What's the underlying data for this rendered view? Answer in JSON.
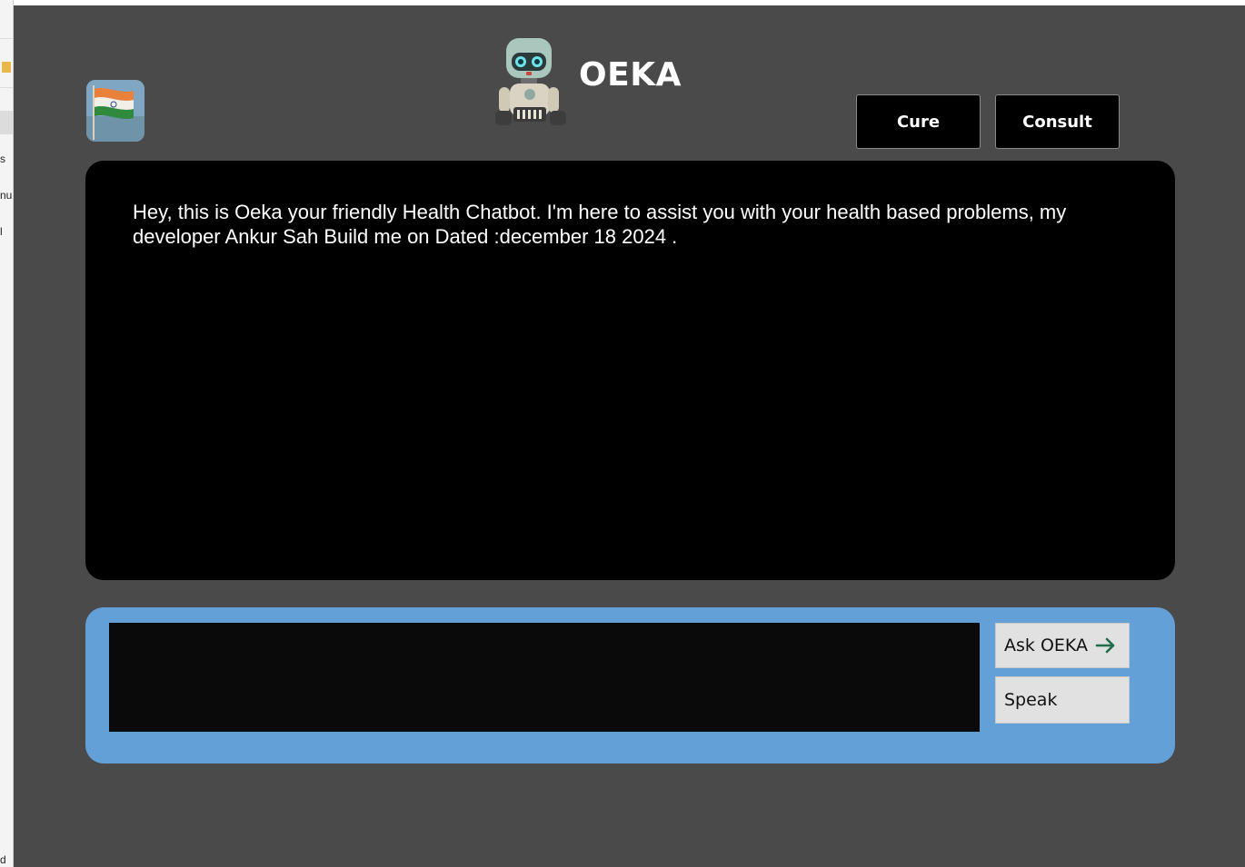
{
  "header": {
    "brand_name": "OEKA",
    "brand_icon": "robot-icon",
    "flag_icon": "india-flag-icon"
  },
  "nav": {
    "cure_label": "Cure",
    "consult_label": "Consult"
  },
  "chat": {
    "bot_message": "Hey, this is Oeka your friendly Health Chatbot. I'm here to assist you with your health based problems, my developer Ankur Sah Build me on Dated :december 18 2024 ."
  },
  "composer": {
    "input_value": "",
    "ask_label": "Ask OEKA",
    "ask_icon": "arrow-right-icon",
    "speak_label": "Speak"
  },
  "colors": {
    "app_background": "#4a4a4a",
    "chat_background": "#000000",
    "composer_background": "#64a0d8",
    "button_background": "#e1e1e1",
    "arrow_color": "#1f6b4a"
  }
}
